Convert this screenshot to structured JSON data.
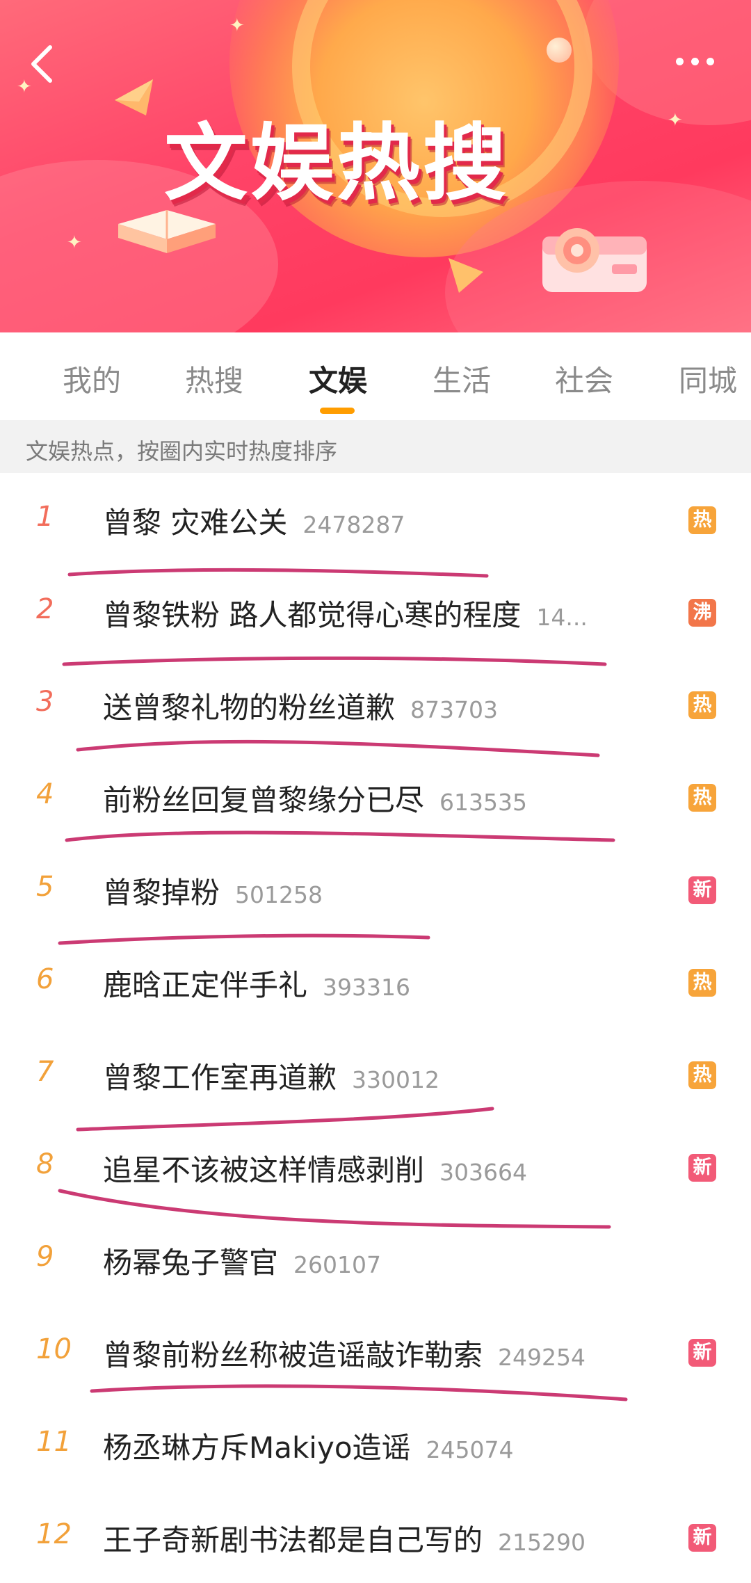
{
  "header": {
    "banner_title": "文娱热搜",
    "back_icon": "chevron-left-icon",
    "more_icon": "more-dots-icon"
  },
  "tabs": [
    {
      "label": "我的",
      "active": false
    },
    {
      "label": "热搜",
      "active": false
    },
    {
      "label": "文娱",
      "active": true
    },
    {
      "label": "生活",
      "active": false
    },
    {
      "label": "社会",
      "active": false
    },
    {
      "label": "同城",
      "active": false
    }
  ],
  "subtitle": "文娱热点，按圈内实时热度排序",
  "colors": {
    "rank_top3": "#f26d5b",
    "rank_other": "#f2a13a",
    "badge_hot": "#f7a43a",
    "badge_boil": "#f2764a",
    "badge_new": "#f25a77",
    "underline": "#c2185b",
    "tab_indicator": "#ff9d00"
  },
  "list": [
    {
      "rank": "1",
      "title": "曾黎 灾难公关",
      "count": "2478287",
      "badge": "热"
    },
    {
      "rank": "2",
      "title": "曾黎铁粉 路人都觉得心寒的程度",
      "count": "14...",
      "badge": "沸"
    },
    {
      "rank": "3",
      "title": "送曾黎礼物的粉丝道歉",
      "count": "873703",
      "badge": "热"
    },
    {
      "rank": "4",
      "title": "前粉丝回复曾黎缘分已尽",
      "count": "613535",
      "badge": "热"
    },
    {
      "rank": "5",
      "title": "曾黎掉粉",
      "count": "501258",
      "badge": "新"
    },
    {
      "rank": "6",
      "title": "鹿晗正定伴手礼",
      "count": "393316",
      "badge": "热"
    },
    {
      "rank": "7",
      "title": "曾黎工作室再道歉",
      "count": "330012",
      "badge": "热"
    },
    {
      "rank": "8",
      "title": "追星不该被这样情感剥削",
      "count": "303664",
      "badge": "新"
    },
    {
      "rank": "9",
      "title": "杨幂兔子警官",
      "count": "260107",
      "badge": ""
    },
    {
      "rank": "10",
      "title": "曾黎前粉丝称被造谣敲诈勒索",
      "count": "249254",
      "badge": "新"
    },
    {
      "rank": "11",
      "title": "杨丞琳方斥Makiyo造谣",
      "count": "245074",
      "badge": ""
    },
    {
      "rank": "12",
      "title": "王子奇新剧书法都是自己写的",
      "count": "215290",
      "badge": "新"
    }
  ]
}
